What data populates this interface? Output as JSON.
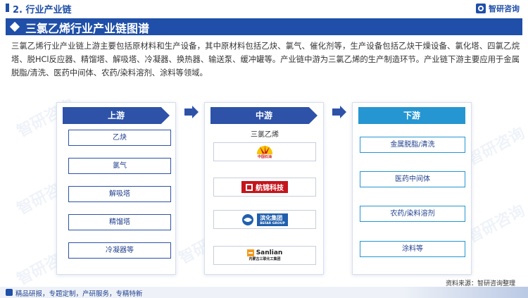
{
  "header": {
    "section_title": "2. 行业产业链",
    "brand_name": "智研咨询"
  },
  "banner": {
    "title": "三氯乙烯行业产业链图谱"
  },
  "intro": {
    "text": "三氯乙烯行业产业链上游主要包括原材料和生产设备，其中原材料包括乙炔、氯气、催化剂等，生产设备包括乙炔干燥设备、氯化塔、四氯乙烷塔、脱HCl反应器、精馏塔、解吸塔、冷凝器、换热器、输送泵、缓冲罐等。产业链中游为三氯乙烯的生产制造环节。产业链下游主要应用于金属脱脂/清洗、医药中间体、农药/染料溶剂、涂料等领域。"
  },
  "upstream": {
    "header": "上游",
    "items": [
      "乙炔",
      "氯气",
      "解吸塔",
      "精馏塔",
      "冷凝器等"
    ]
  },
  "midstream": {
    "header": "中游",
    "label": "三氯乙烯",
    "logos": [
      {
        "name": "中国石油",
        "icon": "petrochina-logo"
      },
      {
        "name": "航锦科技",
        "icon": "hangjin-logo"
      },
      {
        "name": "滨化集团",
        "subtitle": "BEFAR GROUP",
        "icon": "befar-logo"
      },
      {
        "name": "Sanlian",
        "subtitle": "内蒙古三联化工集团",
        "icon": "sanlian-logo"
      }
    ]
  },
  "downstream": {
    "header": "下游",
    "items": [
      "金属脱脂/清洗",
      "医药中间体",
      "农药/染料溶剂",
      "涂料等"
    ]
  },
  "source": "资料来源：智研咨询整理",
  "footer": {
    "text": "精品研报，专题定制，产研服务，专精特新"
  },
  "watermark": "智研咨询",
  "colors": {
    "primary": "#1f4fa8",
    "downstream": "#2596d1",
    "petrochina_red": "#d0181f",
    "hangjin_red": "#c4161c",
    "befar_blue": "#1f5fae",
    "sanlian_orange": "#f39a1e"
  }
}
